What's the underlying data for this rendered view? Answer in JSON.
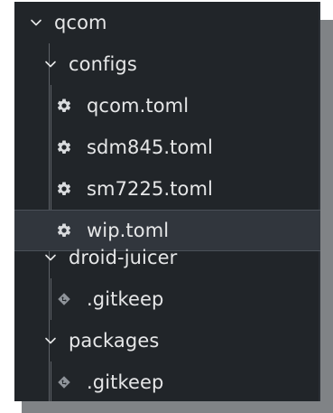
{
  "tree": {
    "items": [
      {
        "label": "qcom",
        "type": "folder",
        "expanded": true,
        "depth": 0,
        "icon": "chevron-down-icon"
      },
      {
        "label": "configs",
        "type": "folder",
        "expanded": true,
        "depth": 1,
        "icon": "chevron-down-icon"
      },
      {
        "label": "qcom.toml",
        "type": "file",
        "depth": 2,
        "icon": "gear-icon"
      },
      {
        "label": "sdm845.toml",
        "type": "file",
        "depth": 2,
        "icon": "gear-icon"
      },
      {
        "label": "sm7225.toml",
        "type": "file",
        "depth": 2,
        "icon": "gear-icon"
      },
      {
        "label": "wip.toml",
        "type": "file",
        "depth": 2,
        "icon": "gear-icon",
        "selected": true
      },
      {
        "label": "droid-juicer",
        "type": "folder",
        "expanded": true,
        "depth": 1,
        "icon": "chevron-down-icon"
      },
      {
        "label": ".gitkeep",
        "type": "file",
        "depth": 2,
        "icon": "git-file-icon"
      },
      {
        "label": "packages",
        "type": "folder",
        "expanded": true,
        "depth": 1,
        "icon": "chevron-down-icon"
      },
      {
        "label": ".gitkeep",
        "type": "file",
        "depth": 2,
        "icon": "git-file-icon"
      }
    ]
  },
  "colors": {
    "panel_bg": "#212529",
    "selected_bg": "#31363d",
    "text": "#e6e7e8",
    "icon_muted": "#8f949a"
  }
}
